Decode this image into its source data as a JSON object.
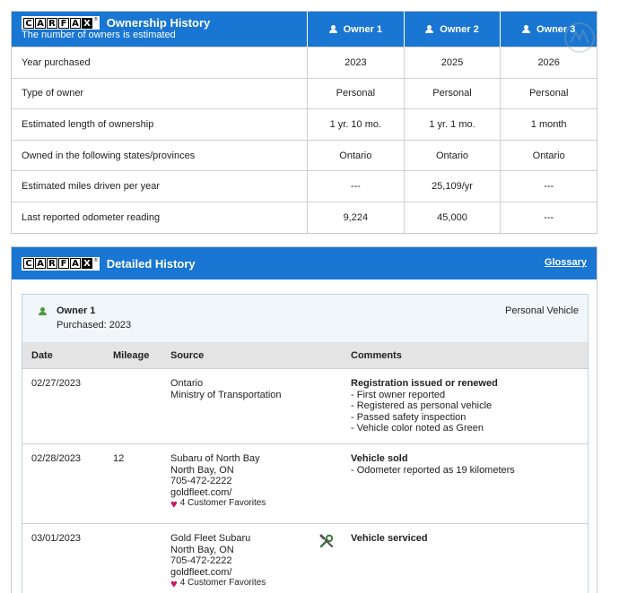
{
  "ownership": {
    "logo_letters": [
      "C",
      "A",
      "R",
      "F",
      "A",
      "X"
    ],
    "logo_mark": "®",
    "title": "Ownership History",
    "subtitle": "The number of owners is estimated",
    "owners": [
      "Owner 1",
      "Owner 2",
      "Owner 3"
    ],
    "rows": [
      {
        "label": "Year purchased",
        "values": [
          "2023",
          "2025",
          "2026"
        ]
      },
      {
        "label": "Type of owner",
        "values": [
          "Personal",
          "Personal",
          "Personal"
        ]
      },
      {
        "label": "Estimated length of ownership",
        "values": [
          "1 yr. 10 mo.",
          "1 yr. 1 mo.",
          "1 month"
        ]
      },
      {
        "label": "Owned in the following states/provinces",
        "values": [
          "Ontario",
          "Ontario",
          "Ontario"
        ]
      },
      {
        "label": "Estimated miles driven per year",
        "values": [
          "---",
          "25,109/yr",
          "---"
        ]
      },
      {
        "label": "Last reported odometer reading",
        "values": [
          "9,224",
          "45,000",
          "---"
        ]
      }
    ]
  },
  "detailed": {
    "title": "Detailed History",
    "glossary_link": "Glossary",
    "owner_box": {
      "name": "Owner 1",
      "purchased": "Purchased: 2023",
      "type": "Personal Vehicle"
    },
    "columns": [
      "Date",
      "Mileage",
      "Source",
      "Comments"
    ],
    "records": [
      {
        "date": "02/27/2023",
        "mileage": "",
        "source": [
          "Ontario",
          "Ministry of Transportation"
        ],
        "favorites": "",
        "comment_head": "Registration issued or renewed",
        "comments": [
          "- First owner reported",
          "- Registered as personal vehicle",
          "- Passed safety inspection",
          "- Vehicle color noted as Green"
        ],
        "icon": ""
      },
      {
        "date": "02/28/2023",
        "mileage": "12",
        "source": [
          "Subaru of North Bay",
          "North Bay, ON",
          "705-472-2222",
          "goldfleet.com/"
        ],
        "favorites": "4 Customer Favorites",
        "comment_head": "Vehicle sold",
        "comments": [
          "- Odometer reported as 19 kilometers"
        ],
        "icon": ""
      },
      {
        "date": "03/01/2023",
        "mileage": "",
        "source": [
          "Gold Fleet Subaru",
          "North Bay, ON",
          "705-472-2222",
          "goldfleet.com/"
        ],
        "favorites": "4 Customer Favorites",
        "comment_head": "Vehicle serviced",
        "comments": [],
        "icon": "wrench-icon"
      }
    ]
  },
  "colors": {
    "brand_blue": "#1976d2",
    "heart": "#c8175d",
    "owner_icon": "#4a9a3a"
  }
}
